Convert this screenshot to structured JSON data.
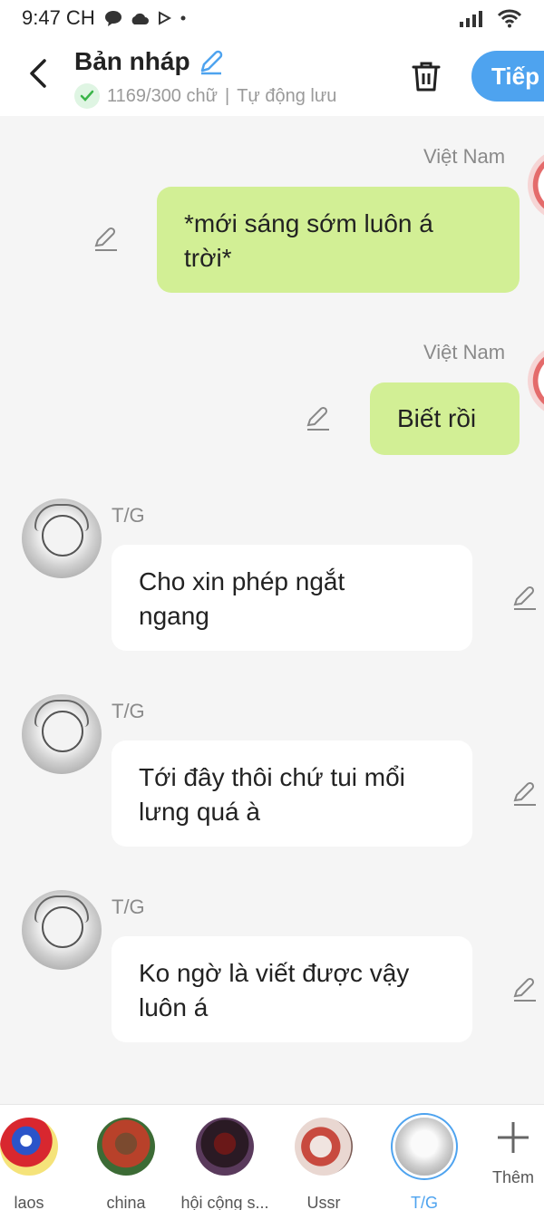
{
  "status": {
    "time": "9:47 CH"
  },
  "header": {
    "title": "Bản nháp",
    "word_count": "1169/300 chữ",
    "separator": "|",
    "autosave": "Tự động lưu",
    "next_label": "Tiếp"
  },
  "messages": [
    {
      "side": "right",
      "sender": "Việt Nam",
      "line1": "*mới sáng sớm luôn á",
      "line2": "trời*"
    },
    {
      "side": "right",
      "sender": "Việt Nam",
      "line1": "Biết rồi",
      "line2": ""
    },
    {
      "side": "left",
      "sender": "T/G",
      "line1": "Cho xin phép ngắt",
      "line2": "ngang"
    },
    {
      "side": "left",
      "sender": "T/G",
      "line1": "Tới đây thôi chứ tui mổi",
      "line2": "lưng quá à"
    },
    {
      "side": "left",
      "sender": "T/G",
      "line1": "Ko ngờ là viết được vậy",
      "line2": "luôn á"
    }
  ],
  "characters": [
    {
      "name": "laos"
    },
    {
      "name": "china"
    },
    {
      "name": "hội cộng s..."
    },
    {
      "name": "Ussr"
    },
    {
      "name": "T/G",
      "selected": true
    }
  ],
  "add_label": "Thêm",
  "colors": {
    "accent": "#4ea3ef",
    "bubble_right": "#d2ef95",
    "bubble_left": "#ffffff"
  }
}
